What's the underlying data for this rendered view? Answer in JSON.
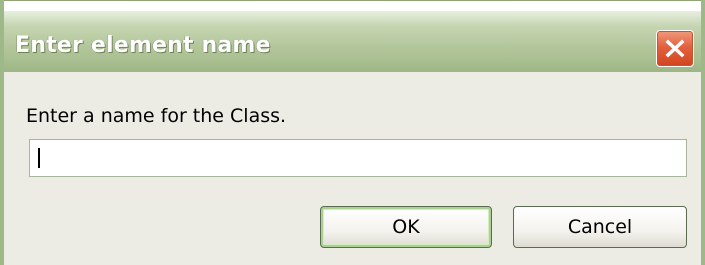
{
  "dialog": {
    "title": "Enter element name",
    "close_icon": "close-icon",
    "prompt": "Enter a name for the Class.",
    "name_input": {
      "value": "",
      "placeholder": ""
    },
    "buttons": {
      "ok_label": "OK",
      "cancel_label": "Cancel"
    }
  },
  "colors": {
    "titlebar": "#b4c79c",
    "window_border": "#9fb889",
    "close_button": "#e2613e",
    "body_background": "#ecebe4",
    "default_button_highlight": "#a9d191"
  }
}
